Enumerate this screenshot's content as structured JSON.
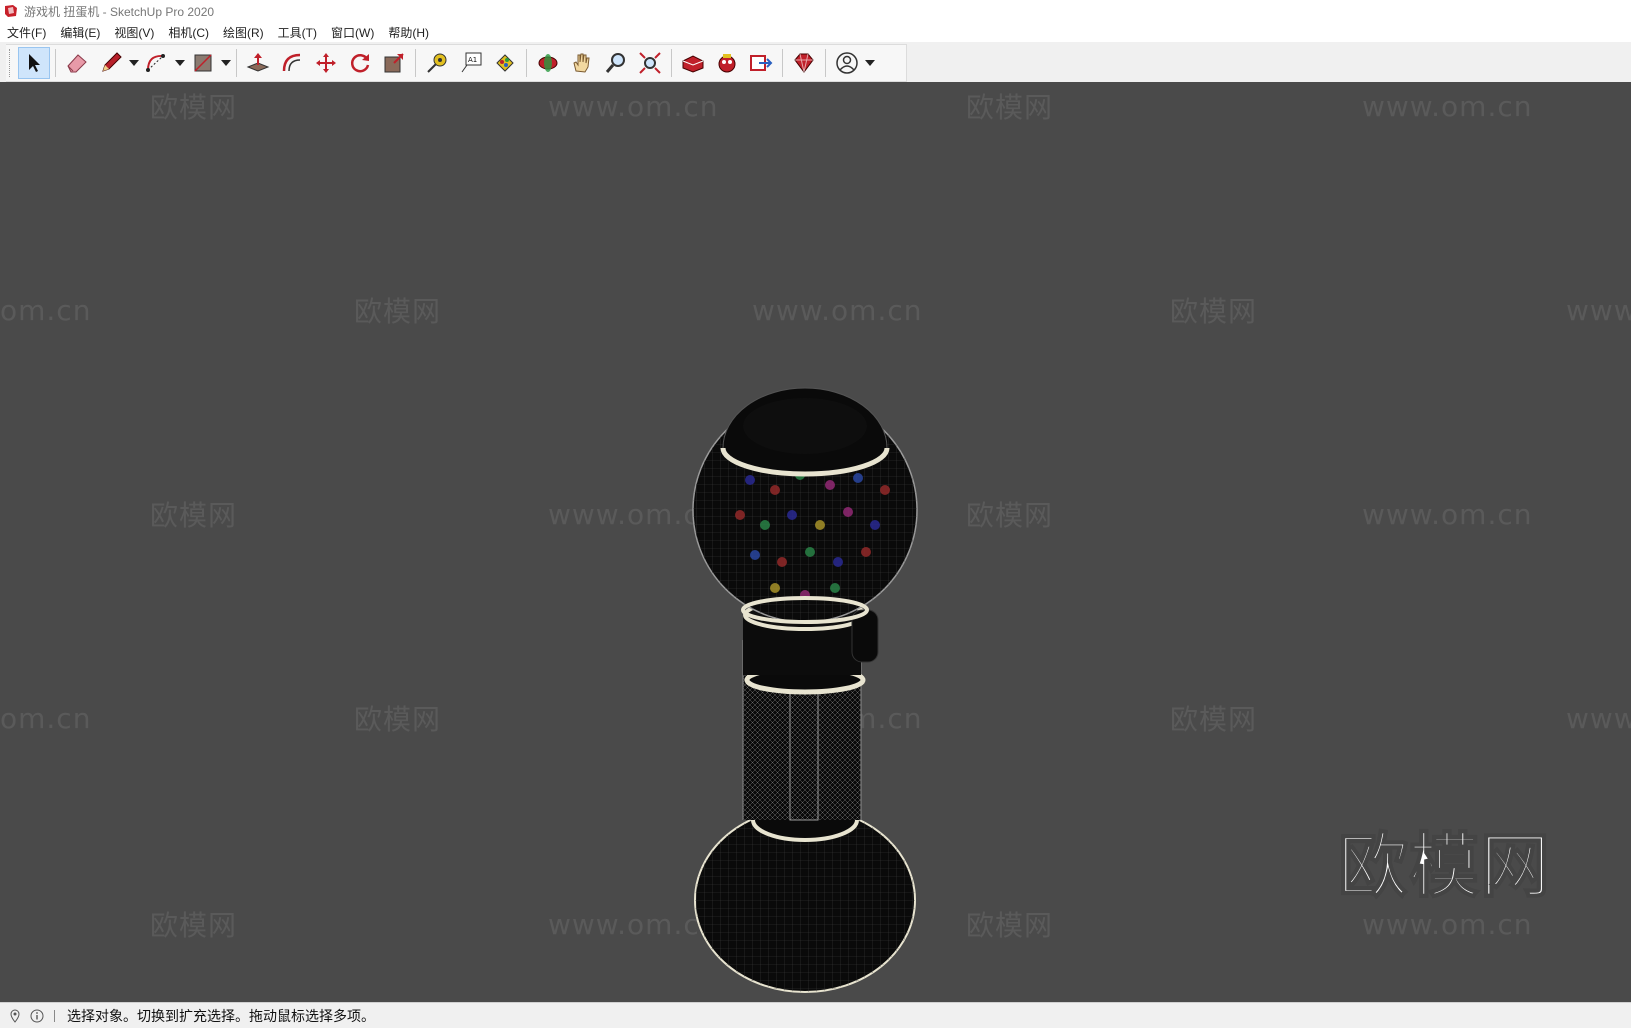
{
  "window": {
    "title": "游戏机 扭蛋机 - SketchUp Pro 2020"
  },
  "menu": [
    {
      "label": "文件(F)"
    },
    {
      "label": "编辑(E)"
    },
    {
      "label": "视图(V)"
    },
    {
      "label": "相机(C)"
    },
    {
      "label": "绘图(R)"
    },
    {
      "label": "工具(T)"
    },
    {
      "label": "窗口(W)"
    },
    {
      "label": "帮助(H)"
    }
  ],
  "toolbar": {
    "tools": [
      {
        "icon": "select-arrow-icon"
      },
      {
        "icon": "eraser-icon"
      },
      {
        "icon": "pencil-line-icon"
      },
      {
        "icon": "arc-icon"
      },
      {
        "icon": "rectangle-shape-icon"
      },
      {
        "icon": "push-pull-icon"
      },
      {
        "icon": "offset-icon"
      },
      {
        "icon": "move-icon"
      },
      {
        "icon": "rotate-icon"
      },
      {
        "icon": "scale-icon"
      },
      {
        "icon": "tape-measure-icon"
      },
      {
        "icon": "text-label-icon"
      },
      {
        "icon": "paint-bucket-icon"
      },
      {
        "icon": "orbit-icon"
      },
      {
        "icon": "pan-hand-icon"
      },
      {
        "icon": "zoom-icon"
      },
      {
        "icon": "zoom-extents-icon"
      },
      {
        "icon": "3d-warehouse-icon"
      },
      {
        "icon": "extension-warehouse-icon"
      },
      {
        "icon": "layout-send-icon"
      },
      {
        "icon": "ruby-extension-icon"
      },
      {
        "icon": "account-user-icon"
      }
    ],
    "text_tool_label": "A1"
  },
  "watermarks": {
    "logo_text": "欧模网",
    "site_text": "www.om.cn",
    "site_text_partial_left": "om.cn",
    "site_text_partial_right": "www."
  },
  "status": {
    "text": "选择对象。切换到扩充选择。拖动鼠标选择多项。"
  }
}
